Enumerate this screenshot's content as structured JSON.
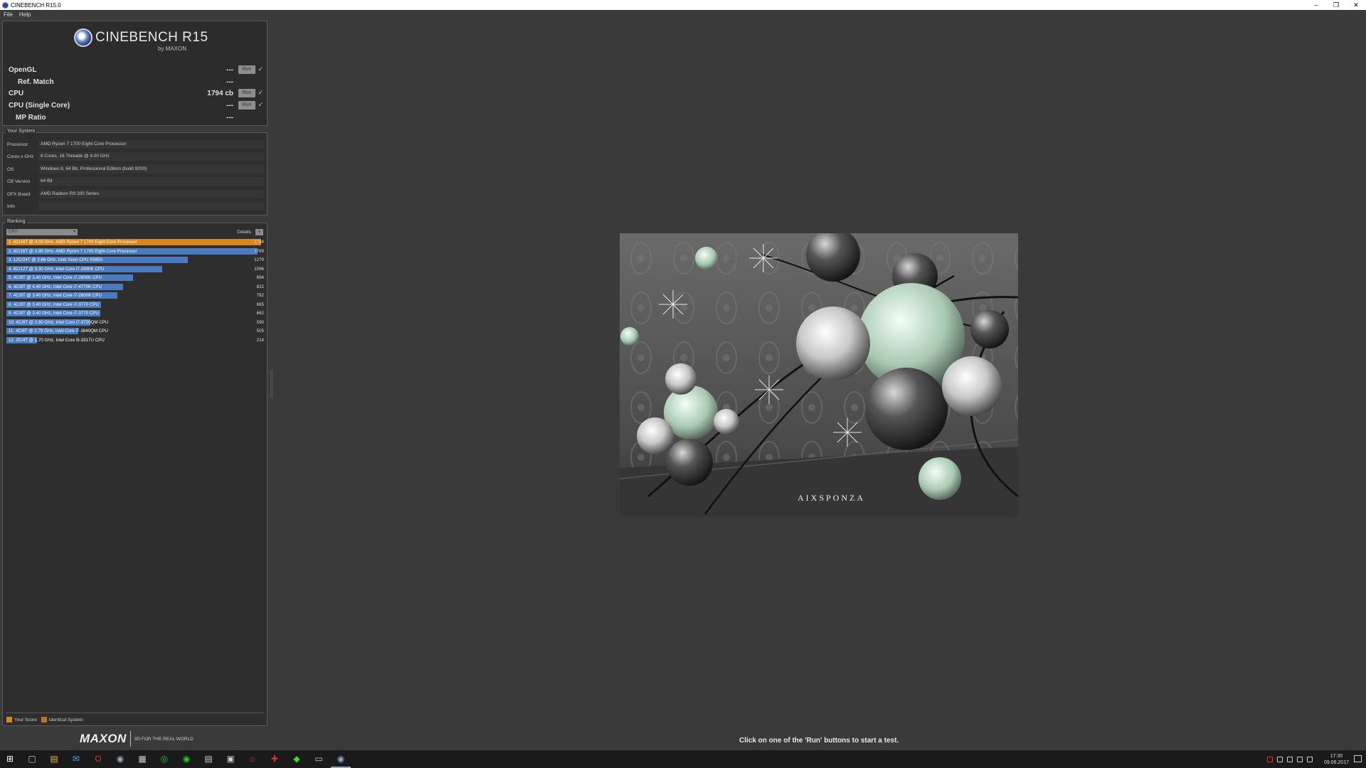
{
  "window": {
    "title": "CINEBENCH R15.0",
    "controls": [
      "–",
      "❐",
      "✕"
    ]
  },
  "menu": [
    "File",
    "Help"
  ],
  "logo": {
    "brand": "CINEBENCH R15",
    "by": "by MAXON"
  },
  "tests": [
    {
      "label": "OpenGL",
      "value": "---",
      "run": "Run",
      "checked": true
    },
    {
      "label": "Ref. Match",
      "value": "---"
    },
    {
      "label": "CPU",
      "value": "1794 cb",
      "run": "Run",
      "checked": true
    },
    {
      "label": "CPU (Single Core)",
      "value": "---",
      "run": "Run",
      "checked": true
    },
    {
      "label": "MP Ratio",
      "value": "---"
    }
  ],
  "system": {
    "title": "Your System",
    "rows": [
      {
        "label": "Processor",
        "value": "AMD Ryzen 7 1700 Eight-Core Processor"
      },
      {
        "label": "Cores x GHz",
        "value": "8 Cores, 16 Threads @ 4.00 GHz"
      },
      {
        "label": "OS",
        "value": "Windows 8, 64 Bit, Professional Edition (build 9200)"
      },
      {
        "label": "CB Version",
        "value": "64 Bit"
      },
      {
        "label": "GFX Board",
        "value": "AMD Radeon R9 200 Series"
      },
      {
        "label": "Info",
        "value": ""
      }
    ]
  },
  "ranking": {
    "title": "Ranking",
    "selected": "CPU",
    "details_label": "Details",
    "max_score": 1794,
    "rows": [
      {
        "text": "1. 8C/16T @ 4.00 GHz, AMD Ryzen 7 1700 Eight-Core Processor",
        "score": 1794,
        "own": true
      },
      {
        "text": "2. 8C/16T @ 3.90 GHz, AMD Ryzen 7 1700 Eight-Core Processor",
        "score": 1769,
        "own": false
      },
      {
        "text": "3. 12C/24T @ 2.66 GHz, Intel Xeon CPU X5650",
        "score": 1279,
        "own": false
      },
      {
        "text": "4. 6C/12T @ 3.30 GHz,  Intel Core i7-3930K CPU",
        "score": 1096,
        "own": false
      },
      {
        "text": "5. 4C/8T @ 3.40 GHz,  Intel Core i7-2600K CPU",
        "score": 894,
        "own": false
      },
      {
        "text": "6. 4C/8T @ 4.40 GHz, Intel Core i7-4770K CPU",
        "score": 822,
        "own": false
      },
      {
        "text": "7. 4C/8T @ 3.40 GHz,  Intel Core i7-2600K CPU",
        "score": 782,
        "own": false
      },
      {
        "text": "8. 4C/8T @ 3.40 GHz,  Intel Core i7-3770 CPU",
        "score": 665,
        "own": false
      },
      {
        "text": "9. 4C/8T @ 3.40 GHz,  Intel Core i7-3770 CPU",
        "score": 662,
        "own": false
      },
      {
        "text": "10. 4C/8T @ 2.60 GHz, Intel Core i7-3720QM CPU",
        "score": 590,
        "own": false
      },
      {
        "text": "11. 4C/8T @ 2.79 GHz,  Intel Core i7-3840QM CPU",
        "score": 505,
        "own": false
      },
      {
        "text": "12. 2C/4T @ 1.70 GHz,  Intel Core i5-3317U CPU",
        "score": 214,
        "own": false
      }
    ],
    "legend": {
      "your_score": "Your Score",
      "identical": "Identical System"
    }
  },
  "footer": {
    "maxon": "MAXON",
    "tagline": "3D FOR THE REAL WORLD"
  },
  "render": {
    "watermark": "AIXSPONZA"
  },
  "status": "Click on one of the 'Run' buttons to start a test.",
  "taskbar": {
    "apps": [
      "windows-start-icon",
      "task-view-icon",
      "file-explorer-icon",
      "mail-icon",
      "opera-icon",
      "steam-icon",
      "calculator-icon",
      "whatsapp-icon",
      "spotify-icon",
      "store-icon",
      "folder-app-icon",
      "tool-icon",
      "game-icon",
      "nvidia-icon",
      "window-icon",
      "cinebench-icon"
    ],
    "time": "17:30",
    "date": "09.06.2017"
  },
  "colors": {
    "own_bar": "#d9861c",
    "other_bar": "#4a7abf",
    "identical": "#c07020"
  }
}
